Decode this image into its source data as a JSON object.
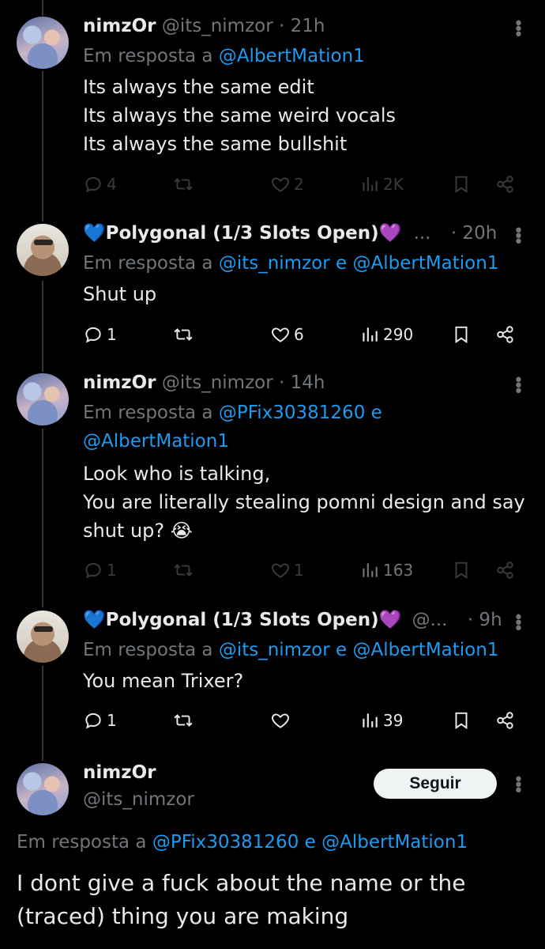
{
  "tweets": [
    {
      "name": "nimzOr",
      "handle": "@its_nimzor",
      "time": "· 21h",
      "reply_prefix": "Em resposta a",
      "reply_to": "@AlbertMation1",
      "text": "Its always the same edit\nIts always the same weird vocals\nIts always the same bullshit",
      "replies": "4",
      "likes": "2",
      "views": "2K"
    },
    {
      "name_emoji_left": "💙",
      "name": "Polygonal (1/3 Slots Open)",
      "name_emoji_right": "💜",
      "handle": "...",
      "time": "· 20h",
      "reply_prefix": "Em resposta a",
      "reply_to_1": "@its_nimzor",
      "reply_joiner": "e",
      "reply_to_2": "@AlbertMation1",
      "text": "Shut up",
      "replies": "1",
      "likes": "6",
      "views": "290"
    },
    {
      "name": "nimzOr",
      "handle": "@its_nimzor",
      "time": "· 14h",
      "reply_prefix": "Em resposta a",
      "reply_to_1": "@PFix30381260",
      "reply_joiner": "e",
      "reply_to_2": "@AlbertMation1",
      "text": "Look who is talking,\nYou are literally stealing pomni design and say shut up? 😭",
      "replies": "1",
      "likes": "1",
      "views": "163"
    },
    {
      "name_emoji_left": "💙",
      "name": "Polygonal (1/3 Slots Open)",
      "name_emoji_right": "💜",
      "handle": "@...",
      "time": "· 9h",
      "reply_prefix": "Em resposta a",
      "reply_to_1": "@its_nimzor",
      "reply_joiner": "e",
      "reply_to_2": "@AlbertMation1",
      "text": "You mean Trixer?",
      "replies": "1",
      "likes": "",
      "views": "39"
    }
  ],
  "main_tweet": {
    "name": "nimzOr",
    "handle": "@its_nimzor",
    "follow_label": "Seguir",
    "reply_prefix": "Em resposta a",
    "reply_to_1": "@PFix30381260",
    "reply_joiner": "e",
    "reply_to_2": "@AlbertMation1",
    "text": "I dont give a fuck about the name or the\n(traced) thing you are making"
  },
  "colors": {
    "background": "#000000",
    "text": "#e7e9ea",
    "muted": "#71767b",
    "link": "#1d9bf0"
  }
}
